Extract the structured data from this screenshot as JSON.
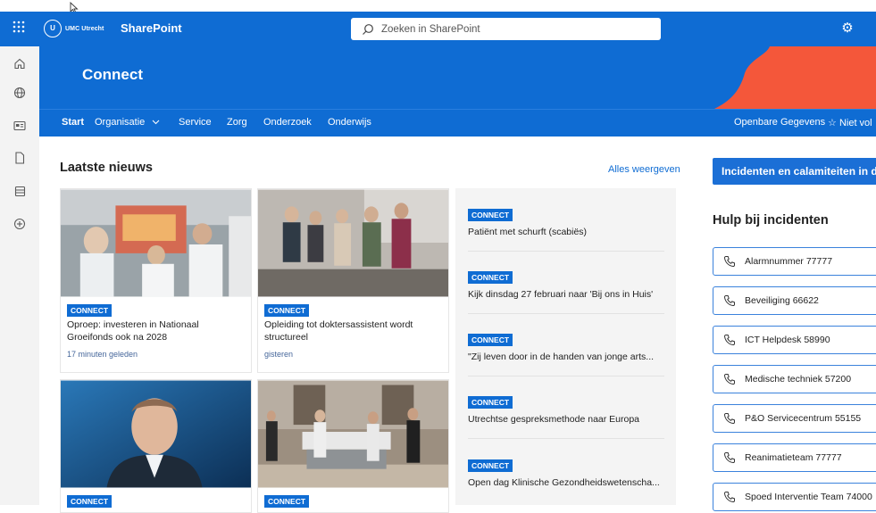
{
  "suite": {
    "logo_text": "UMC Utrecht",
    "brand": "SharePoint",
    "search_placeholder": "Zoeken in SharePoint"
  },
  "site": {
    "title": "Connect"
  },
  "nav": {
    "items": [
      "Start",
      "Organisatie",
      "Service",
      "Zorg",
      "Onderzoek",
      "Onderwijs"
    ],
    "right_link": "Openbare Gegevens",
    "follow": "Niet vol"
  },
  "news": {
    "heading": "Laatste nieuws",
    "see_all": "Alles weergeven",
    "cards": [
      {
        "tag": "CONNECT",
        "title": "Oproep: investeren in Nationaal Groeifonds ook na 2028",
        "meta": "17 minuten geleden"
      },
      {
        "tag": "CONNECT",
        "title": "Opleiding tot doktersassistent wordt structureel",
        "meta": "gisteren"
      },
      {
        "tag": "CONNECT",
        "title": "",
        "meta": ""
      },
      {
        "tag": "CONNECT",
        "title": "",
        "meta": ""
      }
    ],
    "list": [
      {
        "tag": "CONNECT",
        "title": "Patiënt met schurft (scabiës)"
      },
      {
        "tag": "CONNECT",
        "title": "Kijk dinsdag 27 februari naar 'Bij ons in Huis'"
      },
      {
        "tag": "CONNECT",
        "title": "\"Zij leven door in de handen van jonge arts..."
      },
      {
        "tag": "CONNECT",
        "title": "Utrechtse gespreksmethode naar Europa"
      },
      {
        "tag": "CONNECT",
        "title": "Open dag Klinische Gezondheidswetenscha..."
      }
    ]
  },
  "sidebar": {
    "incident_button": "Incidenten en calamiteiten in de",
    "heading": "Hulp bij incidenten",
    "phones": [
      "Alarmnummer 77777",
      "Beveiliging 66622",
      "ICT Helpdesk 58990",
      "Medische techniek 57200",
      "P&O Servicecentrum 55155",
      "Reanimatieteam 77777",
      "Spoed Interventie Team 74000"
    ]
  },
  "colors": {
    "brand_blue": "#0f6cd3",
    "accent_orange": "#f4573a"
  }
}
